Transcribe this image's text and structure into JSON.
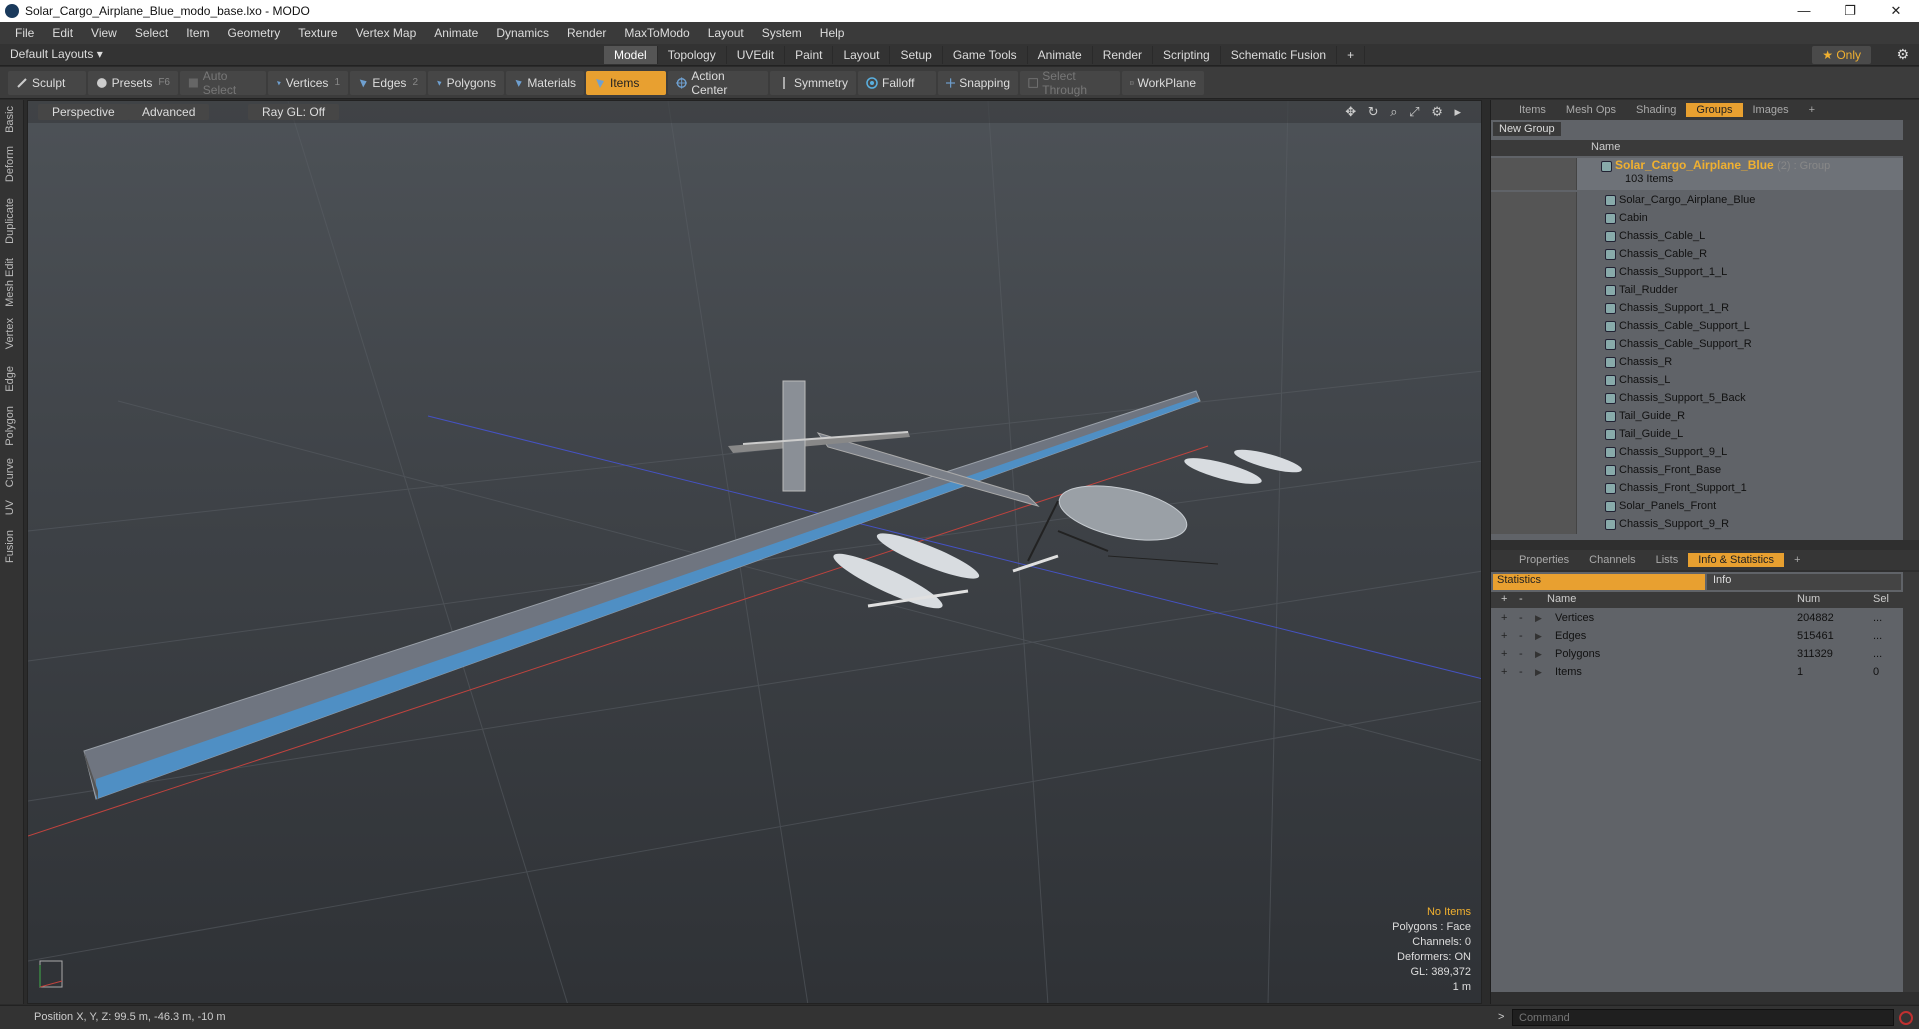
{
  "window": {
    "title": "Solar_Cargo_Airplane_Blue_modo_base.lxo - MODO",
    "minimize": "—",
    "maximize": "❐",
    "close": "✕"
  },
  "menu": [
    "File",
    "Edit",
    "View",
    "Select",
    "Item",
    "Geometry",
    "Texture",
    "Vertex Map",
    "Animate",
    "Dynamics",
    "Render",
    "MaxToModo",
    "Layout",
    "System",
    "Help"
  ],
  "layout_bar": {
    "layouts_label": "Default Layouts ▾",
    "tabs": [
      "Model",
      "Topology",
      "UVEdit",
      "Paint",
      "Layout",
      "Setup",
      "Game Tools",
      "Animate",
      "Render",
      "Scripting",
      "Schematic Fusion",
      "+"
    ],
    "active_tab": "Model",
    "only_label": "★  Only",
    "gear": "⚙"
  },
  "toolbar": {
    "sculpt": "Sculpt",
    "presets": "Presets",
    "presets_key": "F6",
    "auto_select": "Auto Select",
    "vertices": "Vertices",
    "vertices_key": "1",
    "edges": "Edges",
    "edges_key": "2",
    "polygons": "Polygons",
    "materials": "Materials",
    "items": "Items",
    "action_center": "Action Center",
    "symmetry": "Symmetry",
    "falloff": "Falloff",
    "snapping": "Snapping",
    "select_through": "Select Through",
    "workplane": "WorkPlane"
  },
  "left_strip": [
    "Basic",
    "Deform",
    "Duplicate",
    "Mesh Edit",
    "Vertex",
    "Edge",
    "Polygon",
    "Curve",
    "UV",
    "Fusion"
  ],
  "viewport": {
    "view_mode": "Perspective",
    "shading": "Advanced",
    "raygl": "Ray GL: Off",
    "icons": "✥ ↻ ⌕ ⤢ ⚙ ▸",
    "info": {
      "no_items": "No Items",
      "polygons": "Polygons : Face",
      "channels": "Channels: 0",
      "deformers": "Deformers: ON",
      "gl": "GL: 389,372",
      "scale": "1 m"
    }
  },
  "status": {
    "position": "Position X, Y, Z:  99.5 m, -46.3 m, -10 m"
  },
  "upper_panel": {
    "tabs": [
      "Items",
      "Mesh Ops",
      "Shading",
      "Groups",
      "Images",
      "+"
    ],
    "active_tab": "Groups",
    "new_group": "New Group",
    "col_name": "Name",
    "group": {
      "name": "Solar_Cargo_Airplane_Blue",
      "tag": "(2) : Group",
      "count": "103 Items"
    },
    "items": [
      "Solar_Cargo_Airplane_Blue",
      "Cabin",
      "Chassis_Cable_L",
      "Chassis_Cable_R",
      "Chassis_Support_1_L",
      "Tail_Rudder",
      "Chassis_Support_1_R",
      "Chassis_Cable_Support_L",
      "Chassis_Cable_Support_R",
      "Chassis_R",
      "Chassis_L",
      "Chassis_Support_5_Back",
      "Tail_Guide_R",
      "Tail_Guide_L",
      "Chassis_Support_9_L",
      "Chassis_Front_Base",
      "Chassis_Front_Support_1",
      "Solar_Panels_Front",
      "Chassis_Support_9_R"
    ]
  },
  "lower_panel": {
    "tabs": [
      "Properties",
      "Channels",
      "Lists",
      "Info & Statistics",
      "+"
    ],
    "active_tab": "Info & Statistics",
    "sub_statistics": "Statistics",
    "sub_info": "Info",
    "headers": {
      "plus": "+",
      "minus": "-",
      "name": "Name",
      "num": "Num",
      "sel": "Sel"
    },
    "rows": [
      {
        "name": "Vertices",
        "num": "204882",
        "sel": "..."
      },
      {
        "name": "Edges",
        "num": "515461",
        "sel": "..."
      },
      {
        "name": "Polygons",
        "num": "311329",
        "sel": "..."
      },
      {
        "name": "Items",
        "num": "1",
        "sel": "0"
      }
    ]
  },
  "command": {
    "prompt": ">",
    "placeholder": "Command"
  },
  "colors": {
    "accent": "#e8a030",
    "wing_blue": "#4f8fc4",
    "wing_gray": "#6f7580"
  }
}
